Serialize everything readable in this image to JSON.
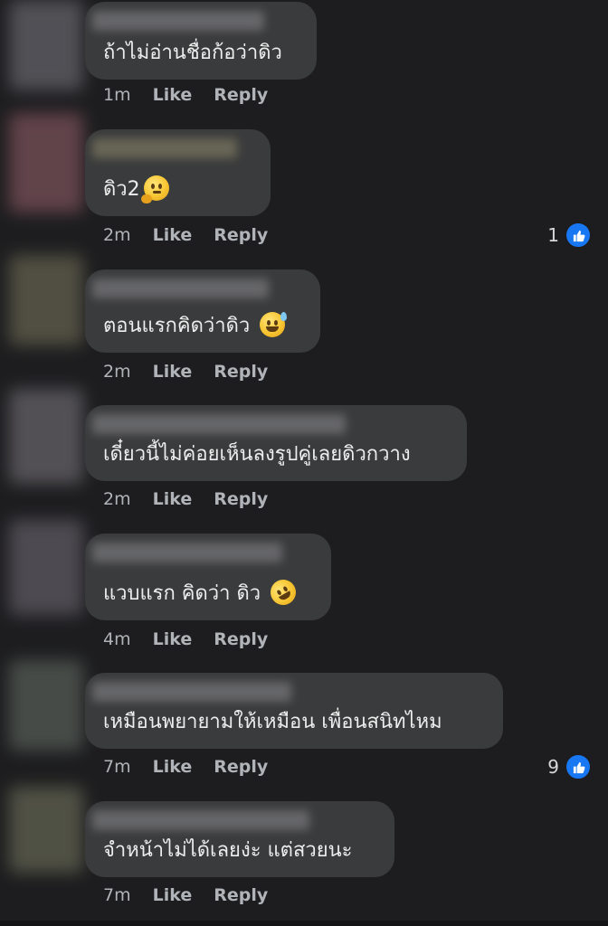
{
  "comments": [
    {
      "text": "ถ้าไม่อ่านชื่อก้อว่าดิว",
      "emoji": "",
      "time": "1m",
      "like": "Like",
      "reply": "Reply",
      "reactions": ""
    },
    {
      "text": "ดิว2",
      "emoji": "thinking-face-icon",
      "time": "2m",
      "like": "Like",
      "reply": "Reply",
      "reactions": "1"
    },
    {
      "text": "ตอนแรกคิดว่าดิว",
      "emoji": "grinning-sweat-icon",
      "time": "2m",
      "like": "Like",
      "reply": "Reply",
      "reactions": ""
    },
    {
      "text": "เดี๋ยวนี้ไม่ค่อยเห็นลงรูปคู่เลยดิวกวาง",
      "emoji": "",
      "time": "2m",
      "like": "Like",
      "reply": "Reply",
      "reactions": ""
    },
    {
      "text": "แวบแรก คิดว่า ดิว",
      "emoji": "rofl-icon",
      "time": "4m",
      "like": "Like",
      "reply": "Reply",
      "reactions": ""
    },
    {
      "text": "เหมือนพยายามให้เหมือน เพื่อนสนิทไหม",
      "emoji": "",
      "time": "7m",
      "like": "Like",
      "reply": "Reply",
      "reactions": "9"
    },
    {
      "text": "จำหน้าไม่ได้เลยง่ะ แต่สวยนะ",
      "emoji": "",
      "time": "7m",
      "like": "Like",
      "reply": "Reply",
      "reactions": ""
    }
  ],
  "colors": {
    "background": "#1d1d1f",
    "bubble": "#3a3b3c",
    "meta_text": "#b0b3b8",
    "like_badge": "#1877f2"
  }
}
